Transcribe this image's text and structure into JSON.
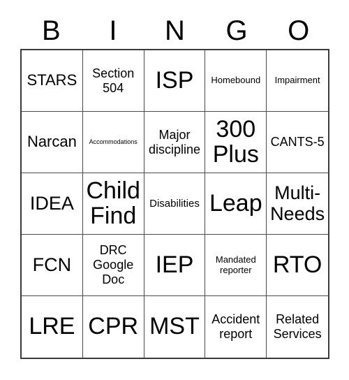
{
  "card": {
    "title": "BINGO",
    "header_letters": [
      "B",
      "I",
      "N",
      "G",
      "O"
    ],
    "rows": [
      [
        {
          "text": "STARS",
          "size": "lg"
        },
        {
          "text": "Section 504",
          "size": "md"
        },
        {
          "text": "ISP",
          "size": "xxl"
        },
        {
          "text": "Homebound",
          "size": "xs"
        },
        {
          "text": "Impairment",
          "size": "xs"
        }
      ],
      [
        {
          "text": "Narcan",
          "size": "lg"
        },
        {
          "text": "Accommodations",
          "size": "xxs"
        },
        {
          "text": "Major discipline",
          "size": "md"
        },
        {
          "text": "300 Plus",
          "size": "xxl"
        },
        {
          "text": "CANTS-5",
          "size": "md"
        }
      ],
      [
        {
          "text": "IDEA",
          "size": "xl"
        },
        {
          "text": "Child Find",
          "size": "xxl"
        },
        {
          "text": "Disabilities",
          "size": "sm"
        },
        {
          "text": "Leap",
          "size": "xxl"
        },
        {
          "text": "Multi-Needs",
          "size": "xl"
        }
      ],
      [
        {
          "text": "FCN",
          "size": "xl"
        },
        {
          "text": "DRC Google Doc",
          "size": "md"
        },
        {
          "text": "IEP",
          "size": "xxl"
        },
        {
          "text": "Mandated reporter",
          "size": "xs"
        },
        {
          "text": "RTO",
          "size": "xxl"
        }
      ],
      [
        {
          "text": "LRE",
          "size": "xxl"
        },
        {
          "text": "CPR",
          "size": "xxl"
        },
        {
          "text": "MST",
          "size": "xxl"
        },
        {
          "text": "Accident report",
          "size": "md"
        },
        {
          "text": "Related Services",
          "size": "md"
        }
      ]
    ]
  },
  "style": {
    "text_color": "#000000",
    "grid_line_color": "#4a4a4a",
    "outer_border_color": "#3a3a3a",
    "background_color": "#ffffff"
  }
}
